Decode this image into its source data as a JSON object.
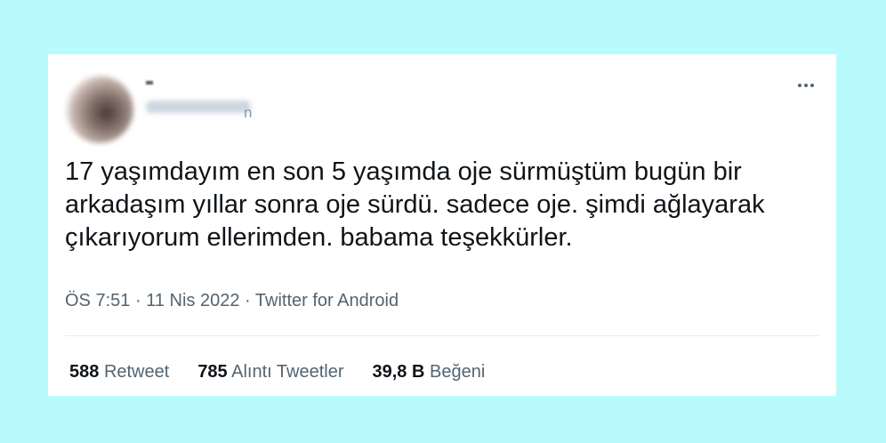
{
  "tweet": {
    "text": "17 yaşımdayım en son 5 yaşımda oje sürmüştüm bugün bir arkadaşım yıllar sonra oje sürdü. sadece oje. şimdi ağlayarak çıkarıyorum ellerimden. babama teşekkürler.",
    "time": "ÖS 7:51",
    "separator": "·",
    "date": "11 Nis 2022",
    "source": "Twitter for Android"
  },
  "user": {
    "name_fragment": "-",
    "handle_tail": "n"
  },
  "stats": {
    "retweets_count": "588",
    "retweets_label": "Retweet",
    "quotes_count": "785",
    "quotes_label": "Alıntı Tweetler",
    "likes_count": "39,8 B",
    "likes_label": "Beğeni"
  },
  "icons": {
    "more": "more-horizontal-icon"
  },
  "colors": {
    "background": "#b9fbfd",
    "card": "#ffffff",
    "text": "#0f1419",
    "secondary": "#536471"
  }
}
